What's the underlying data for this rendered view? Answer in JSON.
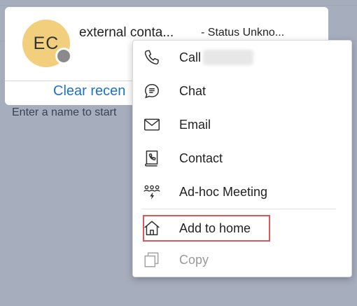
{
  "contact": {
    "initials": "EC",
    "name": "external conta...",
    "status": "- Status Unkno..."
  },
  "clear_recent_label": "Clear recen",
  "hint_text": "Enter a name to start",
  "menu": {
    "items": [
      {
        "label": "Call",
        "icon": "phone-icon"
      },
      {
        "label": "Chat",
        "icon": "chat-icon"
      },
      {
        "label": "Email",
        "icon": "email-icon"
      },
      {
        "label": "Contact",
        "icon": "contact-icon"
      },
      {
        "label": "Ad-hoc Meeting",
        "icon": "meeting-icon"
      },
      {
        "label": "Add to home",
        "icon": "home-icon"
      },
      {
        "label": "Copy",
        "icon": "copy-icon",
        "disabled": true
      }
    ]
  },
  "colors": {
    "accent": "#1a73c8",
    "highlight": "#e0545a",
    "avatar": "#f2cf7c",
    "presence": "#8a8a8a"
  }
}
